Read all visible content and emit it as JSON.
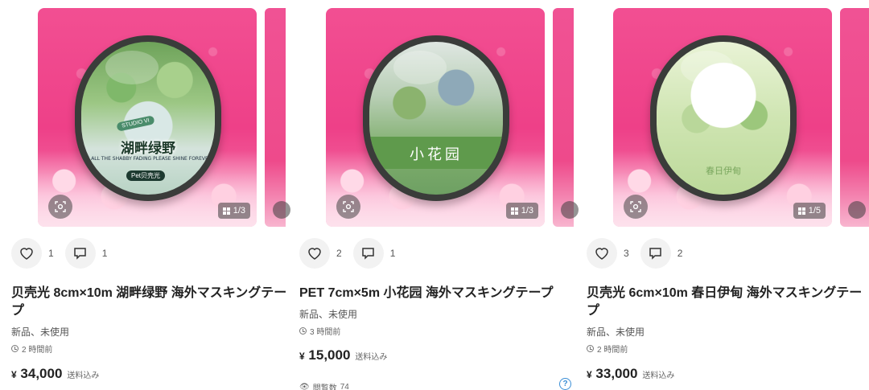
{
  "products": [
    {
      "image": {
        "counter": "1/3",
        "tape_title": "湖畔绿野",
        "tape_brand": "STUDIO VI",
        "tape_subtitle": "IN ALL THE SHABBY FADING PLEASE SHINE FOREVER",
        "tape_badge": "Pet贝壳光"
      },
      "likes": "1",
      "comments": "1",
      "title": "贝壳光 8cm×10m 湖畔绿野 海外マスキングテープ",
      "condition": "新品、未使用",
      "time": "2 時間前",
      "price_currency": "¥",
      "price": "34,000",
      "shipping": "送料込み"
    },
    {
      "image": {
        "counter": "1/3",
        "tape_title": "小花园"
      },
      "likes": "2",
      "comments": "1",
      "title": "PET 7cm×5m 小花园 海外マスキングテープ",
      "condition": "新品、未使用",
      "time": "3 時間前",
      "price_currency": "¥",
      "price": "15,000",
      "shipping": "送料込み",
      "views_label": "閲覧数",
      "views": "74"
    },
    {
      "image": {
        "counter": "1/5",
        "tape_title": "春日伊甸"
      },
      "likes": "3",
      "comments": "2",
      "title": "贝壳光 6cm×10m 春日伊甸 海外マスキングテープ",
      "condition": "新品、未使用",
      "time": "2 時間前",
      "price_currency": "¥",
      "price": "33,000",
      "shipping": "送料込み"
    }
  ],
  "icons": {
    "like": "heart-icon",
    "comment": "comment-icon",
    "zoom": "scan-icon",
    "counter": "grid-icon",
    "time": "clock-icon",
    "views": "eye-icon",
    "help": "question-icon"
  },
  "help_label": "?",
  "colors": {
    "brand_pink": "#ee4088",
    "help_blue": "#3b8fd6"
  }
}
